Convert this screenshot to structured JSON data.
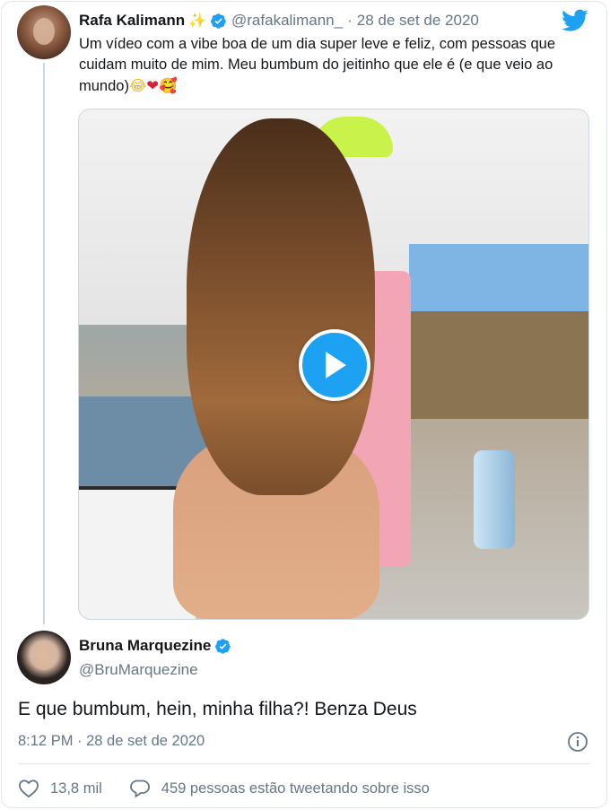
{
  "original_tweet": {
    "author_name": "Rafa Kalimann",
    "author_emoji": "✨",
    "handle": "@rafakalimann_",
    "separator": "·",
    "date": "28 de set de 2020",
    "text": "Um vídeo com a vibe boa de um dia super leve e feliz, com pessoas que cuidam muito de mim. Meu bumbum do jeitinho que ele é (e que veio ao mundo)",
    "emojis": [
      "😂",
      "❤",
      "🥰"
    ]
  },
  "reply": {
    "author_name": "Bruna Marquezine",
    "handle": "@BruMarquezine",
    "text": "E que bumbum, hein, minha filha?! Benza Deus",
    "timestamp": "8:12 PM · 28 de set de 2020"
  },
  "actions": {
    "likes": "13,8 mil",
    "conversation": "459 pessoas estão tweetando sobre isso"
  },
  "icons": {
    "brand": "twitter-bird-icon",
    "verified": "verified-badge-icon",
    "play": "play-icon",
    "info": "info-icon",
    "like": "heart-icon",
    "reply": "speech-bubble-icon"
  },
  "colors": {
    "accent": "#1da1f2",
    "text_primary": "#14171a",
    "text_secondary": "#657786",
    "border": "#e1e8ed"
  }
}
